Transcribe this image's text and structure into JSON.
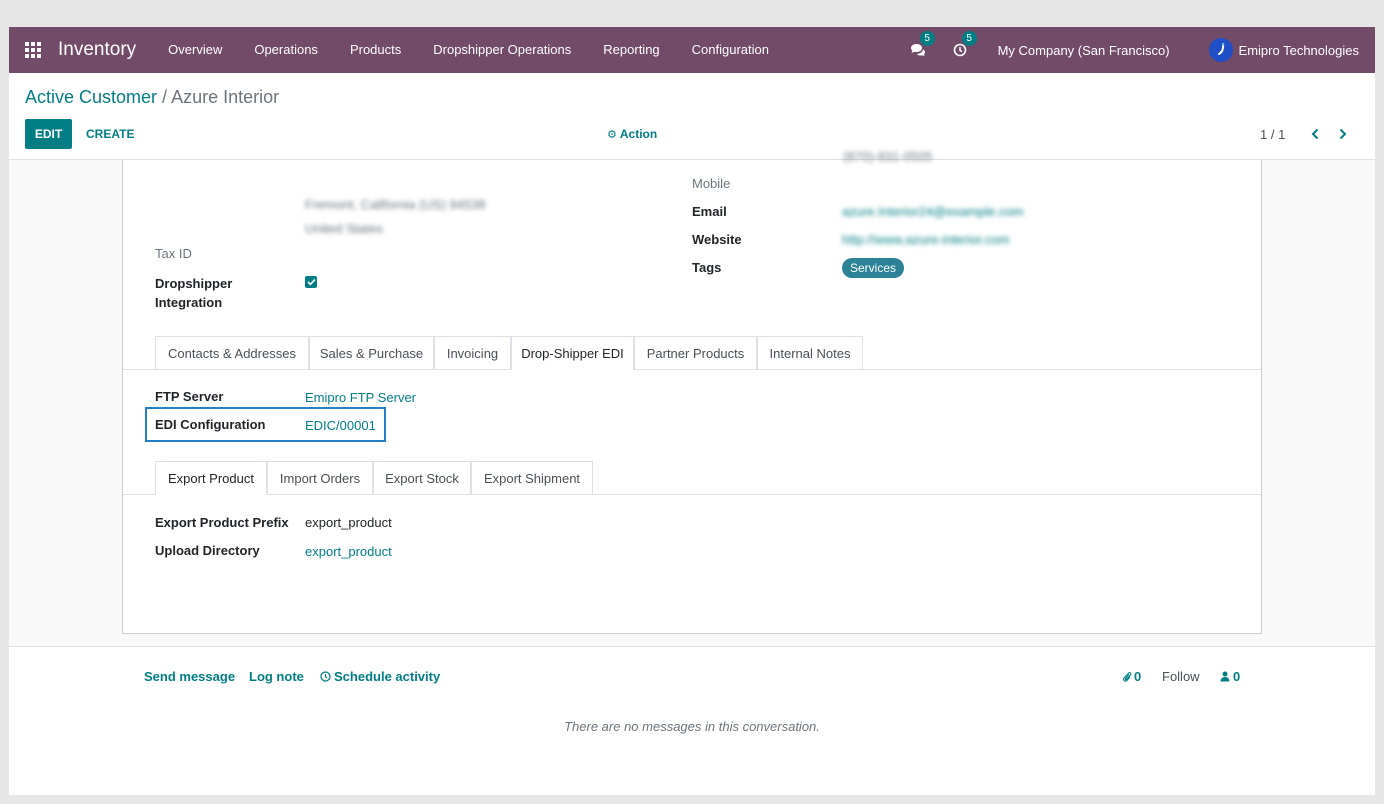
{
  "navbar": {
    "app_name": "Inventory",
    "menu": [
      "Overview",
      "Operations",
      "Products",
      "Dropshipper Operations",
      "Reporting",
      "Configuration"
    ],
    "messages_count": "5",
    "activities_count": "5",
    "company": "My Company (San Francisco)",
    "user": "Emipro Technologies"
  },
  "control": {
    "breadcrumb_parent": "Active Customer",
    "breadcrumb_sep": " / ",
    "breadcrumb_current": "Azure Interior",
    "edit_label": "EDIT",
    "create_label": "CREATE",
    "action_label": "Action",
    "pager": "1 / 1"
  },
  "form": {
    "address_line_1": "Fremont, California (US) 94538",
    "address_line_2": "United States",
    "tax_id_label": "Tax ID",
    "dropshipper_label_1": "Dropshipper",
    "dropshipper_label_2": "Integration",
    "dropshipper_checked": true,
    "partial_top_value": "(870)-931-0505",
    "mobile_label": "Mobile",
    "email_label": "Email",
    "email_value": "azure.Interior24@example.com",
    "website_label": "Website",
    "website_value": "http://www.azure-interior.com",
    "tags_label": "Tags",
    "tag_value": "Services"
  },
  "main_tabs": [
    "Contacts & Addresses",
    "Sales & Purchase",
    "Invoicing",
    "Drop-Shipper EDI",
    "Partner Products",
    "Internal Notes"
  ],
  "main_tab_active": "Drop-Shipper EDI",
  "edi": {
    "ftp_label": "FTP Server",
    "ftp_value": "Emipro FTP Server",
    "config_label": "EDI Configuration",
    "config_value": "EDIC/00001"
  },
  "sub_tabs": [
    "Export Product",
    "Import Orders",
    "Export Stock",
    "Export Shipment"
  ],
  "sub_tab_active": "Export Product",
  "export": {
    "prefix_label": "Export Product Prefix",
    "prefix_value": "export_product",
    "directory_label": "Upload Directory",
    "directory_value": "export_product"
  },
  "chatter": {
    "send_message": "Send message",
    "log_note": "Log note",
    "schedule_activity": "Schedule activity",
    "attachments_count": "0",
    "follow_label": "Follow",
    "followers_count": "0",
    "empty_text": "There are no messages in this conversation."
  },
  "colors": {
    "navbar": "#714b67",
    "primary": "#017e84",
    "highlight": "#2280c9",
    "tag": "#2c8397"
  }
}
